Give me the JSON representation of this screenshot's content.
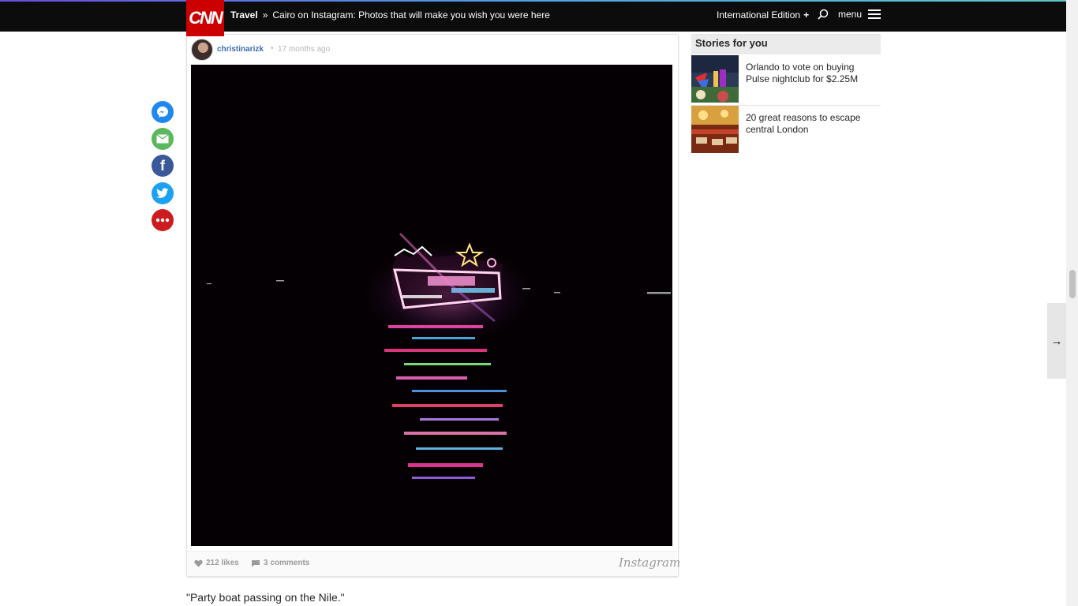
{
  "nav": {
    "logo": "CNN",
    "section": "Travel",
    "separator": "»",
    "headline": "Cairo on Instagram: Photos that will make you wish you were here",
    "edition": "International Edition",
    "edition_plus": "+",
    "menu_label": "menu"
  },
  "post": {
    "username": "christinarizk",
    "time_dot": "•",
    "time_ago": "17 months ago",
    "likes": "212 likes",
    "comments": "3 comments",
    "brand": "Instagram",
    "caption": "\"Party boat passing on the Nile.\""
  },
  "share": [
    {
      "name": "messenger",
      "color": "#1e88f0"
    },
    {
      "name": "email",
      "color": "#5cb85c"
    },
    {
      "name": "facebook",
      "color": "#3b5998"
    },
    {
      "name": "twitter",
      "color": "#1da1f2"
    },
    {
      "name": "more",
      "color": "#cc1c20"
    }
  ],
  "sidebar": {
    "heading": "Stories for you",
    "stories": [
      {
        "title": "Orlando to vote on buying Pulse nightclub for $2.25M"
      },
      {
        "title": "20 great reasons to escape central London"
      }
    ]
  },
  "next_arrow": "→",
  "colors": {
    "brand_red": "#cc0000",
    "nav_bg": "#0c0c0c",
    "link_blue": "#3a6db4"
  }
}
